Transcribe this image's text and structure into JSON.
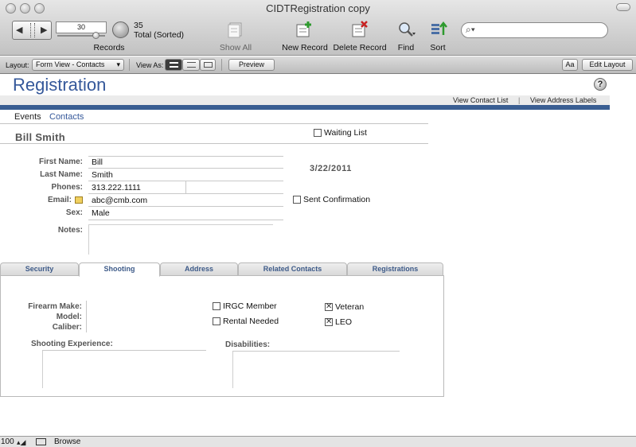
{
  "window": {
    "title": "CIDTRegistration copy"
  },
  "toolbar": {
    "record_number": "30",
    "record_count": "35",
    "record_status": "Total (Sorted)",
    "records_label": "Records",
    "show_all_label": "Show All",
    "new_record_label": "New Record",
    "delete_record_label": "Delete Record",
    "find_label": "Find",
    "sort_label": "Sort"
  },
  "layout_bar": {
    "layout_label": "Layout:",
    "layout_value": "Form View - Contacts",
    "view_as_label": "View As:",
    "preview_label": "Preview",
    "font_button": "Aa",
    "edit_layout_label": "Edit Layout"
  },
  "page": {
    "title": "Registration",
    "help": "?",
    "links": [
      "View Contact List",
      "|",
      "View Address Labels"
    ],
    "subtabs": [
      "Events",
      "Contacts"
    ]
  },
  "contact": {
    "name": "Bill  Smith",
    "waiting_list_label": "Waiting List",
    "date": "3/22/2011",
    "sent_confirmation_label": "Sent Confirmation",
    "fields": {
      "first_name_label": "First Name:",
      "first_name": "Bill",
      "last_name_label": "Last Name:",
      "last_name": "Smith",
      "phones_label": "Phones:",
      "phone": "313.222.1111",
      "email_label": "Email:",
      "email": "abc@cmb.com",
      "sex_label": "Sex:",
      "sex": "Male",
      "notes_label": "Notes:"
    }
  },
  "tabs": [
    "Security",
    "Shooting",
    "Address",
    "Related Contacts",
    "Registrations"
  ],
  "active_tab": "Shooting",
  "shooting": {
    "firearm_make_label": "Firearm Make:",
    "model_label": "Model:",
    "caliber_label": "Caliber:",
    "irgc_member_label": "IRGC Member",
    "irgc_member_checked": false,
    "rental_needed_label": "Rental Needed",
    "rental_needed_checked": false,
    "veteran_label": "Veteran",
    "veteran_checked": true,
    "leo_label": "LEO",
    "leo_checked": true,
    "shooting_experience_label": "Shooting Experience:",
    "disabilities_label": "Disabilities:"
  },
  "status_bar": {
    "zoom": "100",
    "mode": "Browse"
  },
  "colors": {
    "accent": "#3a5e92",
    "title": "#35589a"
  }
}
